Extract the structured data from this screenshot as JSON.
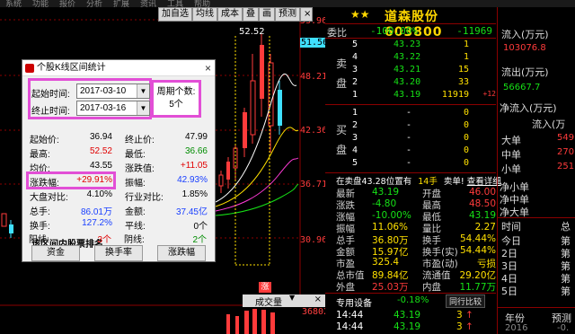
{
  "top_menu": [
    "系统",
    "功能",
    "报价",
    "分析",
    "扩展",
    "资讯",
    "工具",
    "帮助",
    "",
    "",
    "",
    "",
    "",
    "",
    "",
    "",
    "",
    "",
    "",
    "",
    ""
  ],
  "toolbar": {
    "buttons": [
      "加自选",
      "均线",
      "成本",
      "叠",
      "画",
      "预测"
    ],
    "close": "×"
  },
  "chart": {
    "price_labels": [
      "53.96",
      "51.56",
      "48.21",
      "42.36",
      "36.71",
      "30.96"
    ],
    "high_marker": "52.52",
    "bottom_bar": "成交量",
    "vol_label": "36802",
    "zhang_marker": "涨"
  },
  "dialog": {
    "title": "个股K线区间统计",
    "close": "×",
    "start_label": "起始时间:",
    "start_value": "2017-03-10",
    "end_label": "终止时间:",
    "end_value": "2017-03-16",
    "period_label": "周期个数:",
    "period_value": "5个",
    "stats_left": [
      {
        "k": "起始价:",
        "v": "36.94",
        "c": ""
      },
      {
        "k": "最高:",
        "v": "52.52",
        "c": "red"
      },
      {
        "k": "均价:",
        "v": "43.55",
        "c": ""
      },
      {
        "k": "涨跌幅:",
        "v": "+29.91%",
        "c": "red"
      },
      {
        "k": "大盘对比:",
        "v": "4.10%",
        "c": ""
      },
      {
        "k": "总手:",
        "v": "86.01万",
        "c": "blue"
      },
      {
        "k": "换手:",
        "v": "127.2%",
        "c": "blue"
      },
      {
        "k": "阳线:",
        "v": "3个",
        "c": "red"
      }
    ],
    "stats_right": [
      {
        "k": "终止价:",
        "v": "47.99",
        "c": ""
      },
      {
        "k": "最低:",
        "v": "36.66",
        "c": "green"
      },
      {
        "k": "涨跌值:",
        "v": "+11.05",
        "c": "red"
      },
      {
        "k": "振幅:",
        "v": "42.93%",
        "c": "blue"
      },
      {
        "k": "行业对比:",
        "v": "1.85%",
        "c": ""
      },
      {
        "k": "金额:",
        "v": "37.45亿",
        "c": "blue"
      },
      {
        "k": "平线:",
        "v": "0个",
        "c": ""
      },
      {
        "k": "阴线:",
        "v": "2个",
        "c": "green"
      }
    ],
    "rank_title": "该区间内股票排名",
    "rank_buttons": [
      "资金",
      "换手率",
      "涨跌幅"
    ]
  },
  "quote": {
    "stars": "★★",
    "name": "道森股份 603800",
    "webi_label": "委比",
    "webi_value": "-100.00%",
    "webi_diff": "-11969",
    "sell_side": "卖\n盘",
    "buy_side": "买\n盘",
    "sells": [
      {
        "lvl": "5",
        "price": "43.23",
        "vol": "1"
      },
      {
        "lvl": "4",
        "price": "43.22",
        "vol": "1"
      },
      {
        "lvl": "3",
        "price": "43.21",
        "vol": "15"
      },
      {
        "lvl": "2",
        "price": "43.20",
        "vol": "33"
      },
      {
        "lvl": "1",
        "price": "43.19",
        "vol": "11919",
        "chg": "+12"
      }
    ],
    "buys": [
      {
        "lvl": "1",
        "price": "-",
        "vol": "0"
      },
      {
        "lvl": "2",
        "price": "-",
        "vol": "0"
      },
      {
        "lvl": "3",
        "price": "-",
        "vol": "0"
      },
      {
        "lvl": "4",
        "price": "-",
        "vol": "0"
      },
      {
        "lvl": "5",
        "price": "-",
        "vol": "0"
      }
    ],
    "notice": "在卖盘43.28位置有",
    "notice_qty": "14手",
    "notice_tag": "卖单!",
    "notice_link": "查看详细",
    "details": [
      {
        "k1": "最新",
        "v1": "43.19",
        "k2": "开盘",
        "v2": "46.00"
      },
      {
        "k1": "涨跌",
        "v1": "-4.80",
        "k2": "最高",
        "v2": "48.50"
      },
      {
        "k1": "涨幅",
        "v1": "-10.00%",
        "k2": "最低",
        "v2": "43.19"
      },
      {
        "k1": "振幅",
        "v1": "11.06%",
        "k2": "量比",
        "v2": "2.27"
      },
      {
        "k1": "总手",
        "v1": "36.80万",
        "k2": "换手",
        "v2": "54.44%"
      },
      {
        "k1": "金额",
        "v1": "15.97亿",
        "k2": "换手(实)",
        "v2": "54.44%"
      },
      {
        "k1": "市盈",
        "v1": "325.4",
        "k2": "市盈(动)",
        "v2": "亏损"
      },
      {
        "k1": "总市值",
        "v1": "89.84亿",
        "k2": "流通值",
        "v2": "29.20亿"
      },
      {
        "k1": "外盘",
        "v1": "25.03万",
        "k2": "内盘",
        "v2": "11.77万"
      }
    ],
    "equipment_label": "专用设备",
    "equipment_value": "-0.18%",
    "industry_btn": "同行比较",
    "ticks": [
      {
        "t": "14:44",
        "p": "43.19",
        "v": "3",
        "arrow": "↑"
      },
      {
        "t": "14:44",
        "p": "43.19",
        "v": "3",
        "arrow": "↑"
      }
    ]
  },
  "far_right": {
    "labels": [
      "流入(万元)",
      "103076.8",
      "流出(万元)",
      "56667.7",
      "净流入(万元)",
      "流入(万",
      "大单",
      "中单",
      "小单",
      "净小单",
      "净中单",
      "净大单",
      "时间",
      "今日",
      "2日",
      "3日",
      "4日",
      "5日",
      "年份",
      "2016"
    ],
    "col2": [
      "总",
      "549",
      "270",
      "251",
      "第",
      "第",
      "第",
      "第",
      "第",
      "预测",
      "-0."
    ]
  },
  "colors": {
    "up": "#ff3b3b",
    "down": "#16e016",
    "highlight": "#e24fd6",
    "title": "#ffd700"
  }
}
